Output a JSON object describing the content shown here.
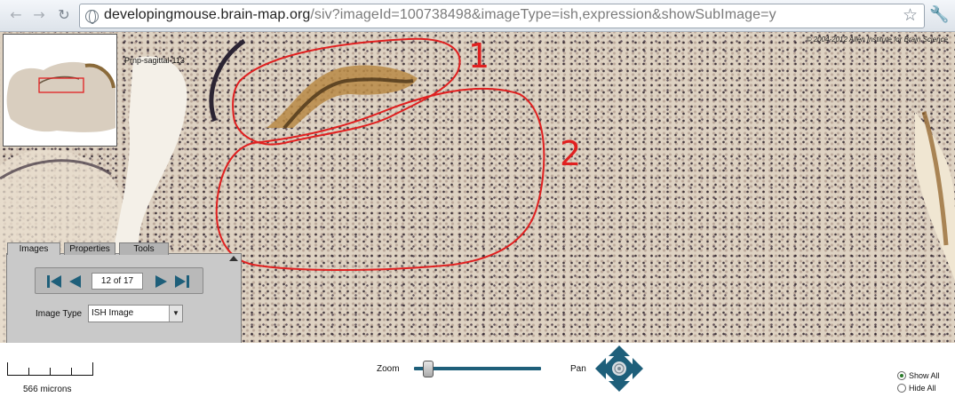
{
  "browser": {
    "url_host": "developingmouse.brain-map.org",
    "url_path": "/siv?imageId=100738498&imageType=ish,expression&showSubImage=y",
    "icons": {
      "back": "back-arrow-icon",
      "forward": "forward-arrow-icon",
      "reload": "reload-icon",
      "star": "bookmark-star-icon",
      "wrench": "wrench-icon",
      "globe": "globe-icon"
    }
  },
  "viewer": {
    "copyright": "© 2004-2012 Allen Institute for Brain Science",
    "thumbnail_label": "Prnp-sagittal-113",
    "annotations": [
      "1",
      "2"
    ],
    "annotation_color": "#e02020"
  },
  "panel": {
    "tabs": [
      "Images",
      "Properties",
      "Tools"
    ],
    "active_tab": "Images",
    "page_counter": "12 of 17",
    "image_type_label": "Image Type",
    "image_type_value": "ISH Image",
    "accent_color": "#1e5f7a"
  },
  "toolbar": {
    "scale_label": "566 microns",
    "zoom_label": "Zoom",
    "zoom_level": 0.08,
    "pan_label": "Pan",
    "show_all_label": "Show All",
    "hide_all_label": "Hide All",
    "selected_visibility": "Show All"
  }
}
